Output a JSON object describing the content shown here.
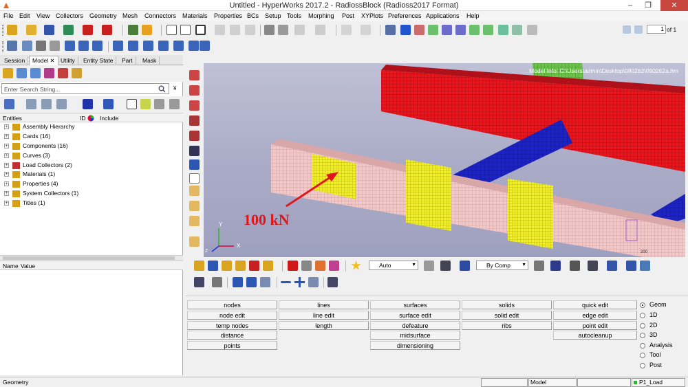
{
  "window": {
    "title": "Untitled - HyperWorks 2017.2 - RadiossBlock (Radioss2017 Format)",
    "minimize": "–",
    "maximize": "❐",
    "close": "✕"
  },
  "menu": [
    "File",
    "Edit",
    "View",
    "Collectors",
    "Geometry",
    "Mesh",
    "Connectors",
    "Materials",
    "Properties",
    "BCs",
    "Setup",
    "Tools",
    "Morphing",
    "Post",
    "XYPlots",
    "Preferences",
    "Applications",
    "Help"
  ],
  "page_nav": {
    "current": "1",
    "of_label": "of 1"
  },
  "left_panel": {
    "tabs": [
      "Session",
      "Model",
      "Utility",
      "Entity State",
      "Part",
      "Mask"
    ],
    "model_tab_close": "✕",
    "search_placeholder": "Enter Search String...",
    "columns": {
      "entities": "Entities",
      "id": "ID",
      "include": "Include"
    },
    "tree": [
      {
        "label": "Assembly Hierarchy",
        "icon_color": "#d4a017"
      },
      {
        "label": "Cards (16)",
        "icon_color": "#d4a017"
      },
      {
        "label": "Components (16)",
        "icon_color": "#d4a017"
      },
      {
        "label": "Curves (3)",
        "icon_color": "#d4a017"
      },
      {
        "label": "Load Collectors (2)",
        "icon_color": "#c03030"
      },
      {
        "label": "Materials (1)",
        "icon_color": "#d4a017"
      },
      {
        "label": "Properties (4)",
        "icon_color": "#d4a017"
      },
      {
        "label": "System Collectors (1)",
        "icon_color": "#d4a017"
      },
      {
        "label": "Titles (1)",
        "icon_color": "#d4a017"
      }
    ],
    "name_value": {
      "name": "Name",
      "value": "Value"
    }
  },
  "viewport": {
    "model_info": "Model Info: C:\\Users\\admin\\Desktop\\080262\\090262a.hm",
    "annotation": "100 kN",
    "scale_label": "200",
    "axis_y": "Y",
    "axis_x": "X",
    "axis_z": "Z"
  },
  "lower_toolbar": {
    "auto_label": "Auto",
    "bycomp_label": "By Comp"
  },
  "panel": {
    "columns": [
      [
        "nodes",
        "node edit",
        "temp nodes",
        "distance",
        "points"
      ],
      [
        "lines",
        "line edit",
        "length"
      ],
      [
        "surfaces",
        "surface edit",
        "defeature",
        "midsurface",
        "dimensioning"
      ],
      [
        "solids",
        "solid edit",
        "ribs"
      ],
      [
        "quick edit",
        "edge edit",
        "point edit",
        "autocleanup"
      ]
    ],
    "modes": [
      "Geom",
      "1D",
      "2D",
      "3D",
      "Analysis",
      "Tool",
      "Post"
    ],
    "selected_mode": "Geom"
  },
  "status": {
    "left": "Geometry",
    "model": "Model",
    "load": "P1_Load"
  },
  "colors": {
    "beam_red": "#e8151c",
    "beam_blue": "#1b22c8",
    "beam_pink": "#f2c7c7",
    "patch_yellow": "#f4f01e",
    "column_green": "#6cc24a",
    "arrow_red": "#e0161a"
  }
}
